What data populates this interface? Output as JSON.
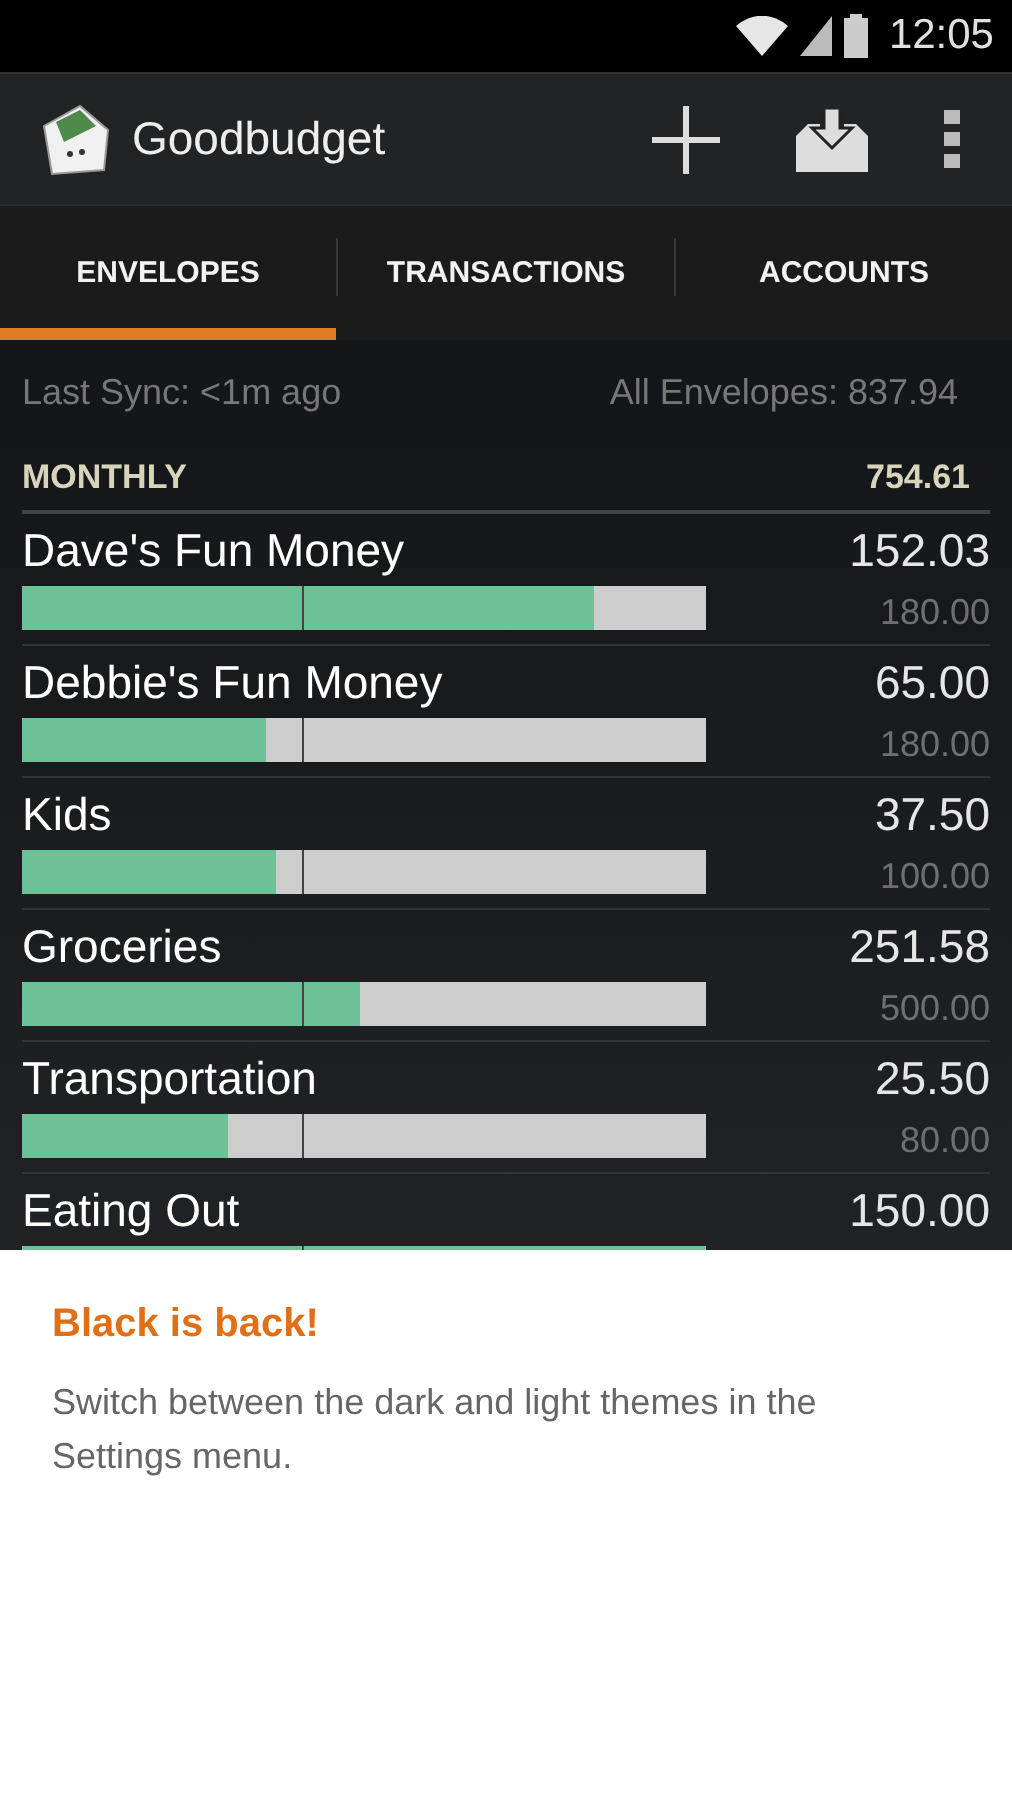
{
  "status_bar": {
    "time": "12:05"
  },
  "action_bar": {
    "title": "Goodbudget"
  },
  "tabs": [
    {
      "label": "ENVELOPES",
      "selected": true
    },
    {
      "label": "TRANSACTIONS",
      "selected": false
    },
    {
      "label": "ACCOUNTS",
      "selected": false
    }
  ],
  "sync": {
    "last_sync": "Last Sync: <1m ago",
    "total": "All Envelopes: 837.94"
  },
  "group": {
    "name": "MONTHLY",
    "total": "754.61",
    "period": {
      "level": 0.41
    }
  },
  "envelopes": [
    {
      "name": "Dave's Fun Money",
      "amount": "152.03",
      "budget": "180.00",
      "level": 0.836
    },
    {
      "name": "Debbie's Fun Money",
      "amount": "65.00",
      "budget": "180.00",
      "level": 0.357
    },
    {
      "name": "Kids",
      "amount": "37.50",
      "budget": "100.00",
      "level": 0.371
    },
    {
      "name": "Groceries",
      "amount": "251.58",
      "budget": "500.00",
      "level": 0.494
    },
    {
      "name": "Transportation",
      "amount": "25.50",
      "budget": "80.00",
      "level": 0.301
    },
    {
      "name": "Eating Out",
      "amount": "150.00",
      "level": 1.0
    }
  ],
  "tip": {
    "title": "Black is back!",
    "text": "Switch between the dark and light themes in the Settings menu."
  }
}
